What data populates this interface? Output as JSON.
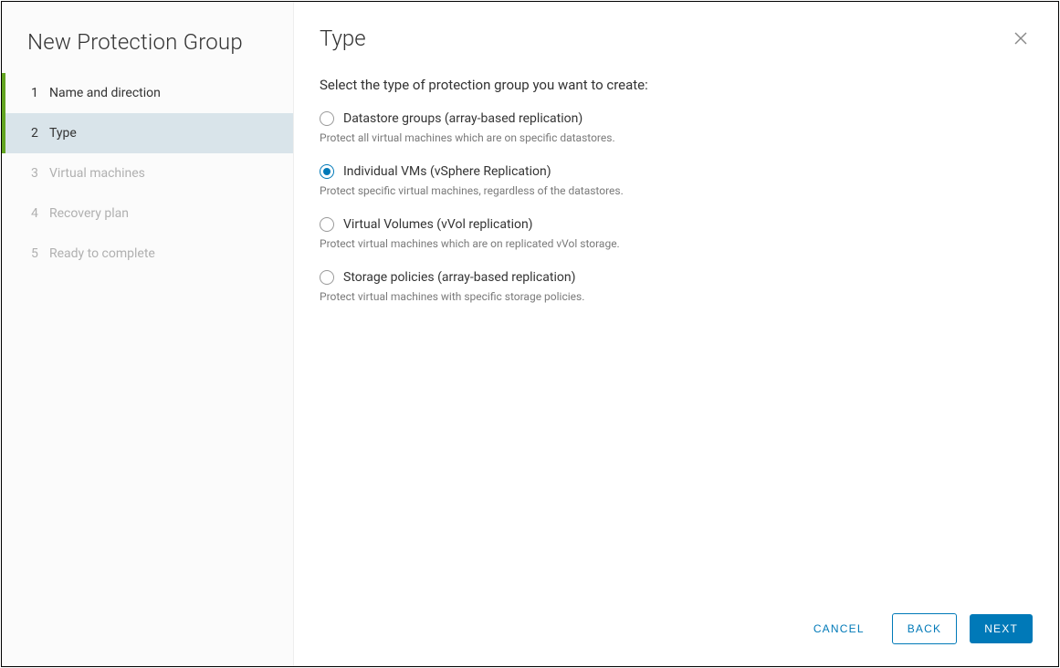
{
  "sidebar": {
    "title": "New Protection Group",
    "steps": [
      {
        "num": "1",
        "label": "Name and direction"
      },
      {
        "num": "2",
        "label": "Type"
      },
      {
        "num": "3",
        "label": "Virtual machines"
      },
      {
        "num": "4",
        "label": "Recovery plan"
      },
      {
        "num": "5",
        "label": "Ready to complete"
      }
    ],
    "active_index": 1
  },
  "main": {
    "title": "Type",
    "instruction": "Select the type of protection group you want to create:",
    "options": [
      {
        "label": "Datastore groups (array-based replication)",
        "desc": "Protect all virtual machines which are on specific datastores.",
        "selected": false
      },
      {
        "label": "Individual VMs (vSphere Replication)",
        "desc": "Protect specific virtual machines, regardless of the datastores.",
        "selected": true
      },
      {
        "label": "Virtual Volumes (vVol replication)",
        "desc": "Protect virtual machines which are on replicated vVol storage.",
        "selected": false
      },
      {
        "label": "Storage policies (array-based replication)",
        "desc": "Protect virtual machines with specific storage policies.",
        "selected": false
      }
    ]
  },
  "footer": {
    "cancel": "CANCEL",
    "back": "BACK",
    "next": "NEXT"
  }
}
